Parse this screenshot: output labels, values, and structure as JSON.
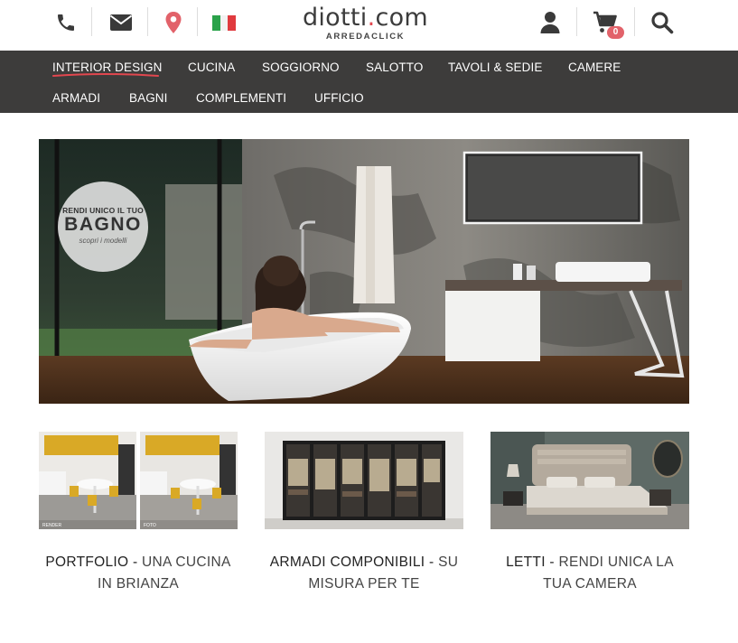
{
  "header": {
    "logo_text": "diotti",
    "logo_dot": ".",
    "logo_tld": "com",
    "logo_sub": "ARREDACLICK",
    "cart_count": "0",
    "icons": [
      "phone-icon",
      "mail-icon",
      "location-icon",
      "italy-flag-icon",
      "user-icon",
      "cart-icon",
      "search-icon"
    ],
    "accent_color": "#e2474f"
  },
  "nav": {
    "items": [
      "INTERIOR DESIGN",
      "CUCINA",
      "SOGGIORNO",
      "SALOTTO",
      "TAVOLI & SEDIE",
      "CAMERE",
      "ARMADI",
      "BAGNI",
      "COMPLEMENTI",
      "UFFICIO"
    ]
  },
  "hero": {
    "badge_line1": "RENDI UNICO IL TUO",
    "badge_line2": "BAGNO",
    "badge_line3": "scopri i modelli"
  },
  "cards": [
    {
      "title_strong": "PORTFOLIO -",
      "title_rest": " UNA CUCINA IN BRIANZA",
      "img_labels": [
        "RENDER",
        "FOTO"
      ]
    },
    {
      "title_strong": "ARMADI COMPONIBILI -",
      "title_rest": " SU MISURA PER TE"
    },
    {
      "title_strong": "LETTI -",
      "title_rest": " RENDI UNICA LA TUA CAMERA"
    }
  ]
}
